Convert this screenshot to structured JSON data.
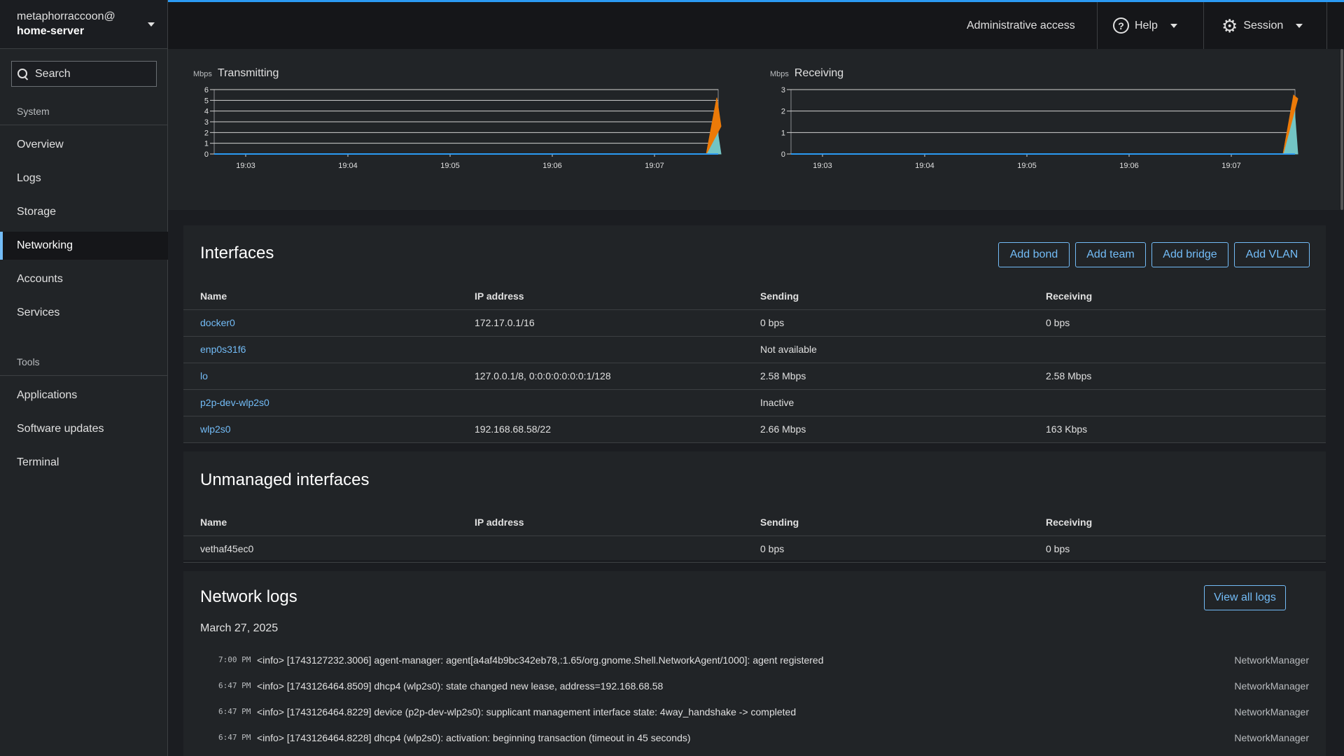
{
  "host": {
    "user": "metaphorraccoon@",
    "server": "home-server"
  },
  "search": {
    "placeholder": "Search"
  },
  "sidebar": {
    "system_label": "System",
    "tools_label": "Tools",
    "system_items": [
      {
        "label": "Overview"
      },
      {
        "label": "Logs"
      },
      {
        "label": "Storage"
      },
      {
        "label": "Networking"
      },
      {
        "label": "Accounts"
      },
      {
        "label": "Services"
      }
    ],
    "tools_items": [
      {
        "label": "Applications"
      },
      {
        "label": "Software updates"
      },
      {
        "label": "Terminal"
      }
    ]
  },
  "topbar": {
    "admin_label": "Administrative access",
    "help_label": "Help",
    "session_label": "Session"
  },
  "chart_data": [
    {
      "type": "area",
      "title": "Transmitting",
      "ylabel": "Mbps",
      "ylim": [
        0,
        6
      ],
      "yticks": [
        "0",
        "1",
        "2",
        "3",
        "4",
        "5",
        "6"
      ],
      "xticks": [
        "19:03",
        "19:04",
        "19:05",
        "19:06",
        "19:07"
      ],
      "series": [
        {
          "color": "#73c5c5",
          "values": [
            0,
            0,
            0,
            0,
            0,
            0,
            0,
            0,
            0,
            0,
            0,
            0,
            0,
            0,
            0,
            0,
            0,
            0,
            0,
            0,
            0,
            0,
            0,
            0,
            0,
            0,
            0,
            0,
            0,
            0,
            0,
            0,
            0,
            0,
            0,
            0,
            0,
            0,
            0,
            0,
            0,
            0,
            0,
            0,
            0,
            0,
            0,
            0,
            2.58
          ]
        },
        {
          "color": "#ec7a08",
          "values": [
            0,
            0,
            0,
            0,
            0,
            0,
            0,
            0,
            0,
            0,
            0,
            0,
            0,
            0,
            0,
            0,
            0,
            0,
            0,
            0,
            0,
            0,
            0,
            0,
            0,
            0,
            0,
            0,
            0,
            0,
            0,
            0,
            0,
            0,
            0,
            0,
            0,
            0,
            0,
            0,
            0,
            0,
            0,
            0,
            0,
            0,
            0,
            0,
            2.66
          ]
        }
      ]
    },
    {
      "type": "area",
      "title": "Receiving",
      "ylabel": "Mbps",
      "ylim": [
        0,
        3
      ],
      "yticks": [
        "0",
        "1",
        "2",
        "3"
      ],
      "xticks": [
        "19:03",
        "19:04",
        "19:05",
        "19:06",
        "19:07"
      ],
      "series": [
        {
          "color": "#73c5c5",
          "values": [
            0,
            0,
            0,
            0,
            0,
            0,
            0,
            0,
            0,
            0,
            0,
            0,
            0,
            0,
            0,
            0,
            0,
            0,
            0,
            0,
            0,
            0,
            0,
            0,
            0,
            0,
            0,
            0,
            0,
            0,
            0,
            0,
            0,
            0,
            0,
            0,
            0,
            0,
            0,
            0,
            0,
            0,
            0,
            0,
            0,
            0,
            0,
            0,
            2.58
          ]
        },
        {
          "color": "#ec7a08",
          "values": [
            0,
            0,
            0,
            0,
            0,
            0,
            0,
            0,
            0,
            0,
            0,
            0,
            0,
            0,
            0,
            0,
            0,
            0,
            0,
            0,
            0,
            0,
            0,
            0,
            0,
            0,
            0,
            0,
            0,
            0,
            0,
            0,
            0,
            0,
            0,
            0,
            0,
            0,
            0,
            0,
            0,
            0,
            0,
            0,
            0,
            0,
            0,
            0,
            0.16
          ]
        }
      ]
    }
  ],
  "interfaces": {
    "title": "Interfaces",
    "buttons": [
      "Add bond",
      "Add team",
      "Add bridge",
      "Add VLAN"
    ],
    "columns": [
      "Name",
      "IP address",
      "Sending",
      "Receiving"
    ],
    "rows": [
      {
        "name": "docker0",
        "ip": "172.17.0.1/16",
        "sending": "0 bps",
        "receiving": "0 bps"
      },
      {
        "name": "enp0s31f6",
        "ip": "",
        "sending": "Not available",
        "receiving": ""
      },
      {
        "name": "lo",
        "ip": "127.0.0.1/8, 0:0:0:0:0:0:0:1/128",
        "sending": "2.58 Mbps",
        "receiving": "2.58 Mbps"
      },
      {
        "name": "p2p-dev-wlp2s0",
        "ip": "",
        "sending": "Inactive",
        "receiving": ""
      },
      {
        "name": "wlp2s0",
        "ip": "192.168.68.58/22",
        "sending": "2.66 Mbps",
        "receiving": "163 Kbps"
      }
    ]
  },
  "unmanaged": {
    "title": "Unmanaged interfaces",
    "columns": [
      "Name",
      "IP address",
      "Sending",
      "Receiving"
    ],
    "rows": [
      {
        "name": "vethaf45ec0",
        "ip": "",
        "sending": "0 bps",
        "receiving": "0 bps"
      }
    ]
  },
  "logs": {
    "title": "Network logs",
    "view_all_label": "View all logs",
    "date": "March 27, 2025",
    "entries": [
      {
        "time": "7:00 PM",
        "message": "<info> [1743127232.3006] agent-manager: agent[a4af4b9bc342eb78,:1.65/org.gnome.Shell.NetworkAgent/1000]: agent registered",
        "source": "NetworkManager"
      },
      {
        "time": "6:47 PM",
        "message": "<info> [1743126464.8509] dhcp4 (wlp2s0): state changed new lease, address=192.168.68.58",
        "source": "NetworkManager"
      },
      {
        "time": "6:47 PM",
        "message": "<info> [1743126464.8229] device (p2p-dev-wlp2s0): supplicant management interface state: 4way_handshake -> completed",
        "source": "NetworkManager"
      },
      {
        "time": "6:47 PM",
        "message": "<info> [1743126464.8228] dhcp4 (wlp2s0): activation: beginning transaction (timeout in 45 seconds)",
        "source": "NetworkManager"
      }
    ]
  }
}
